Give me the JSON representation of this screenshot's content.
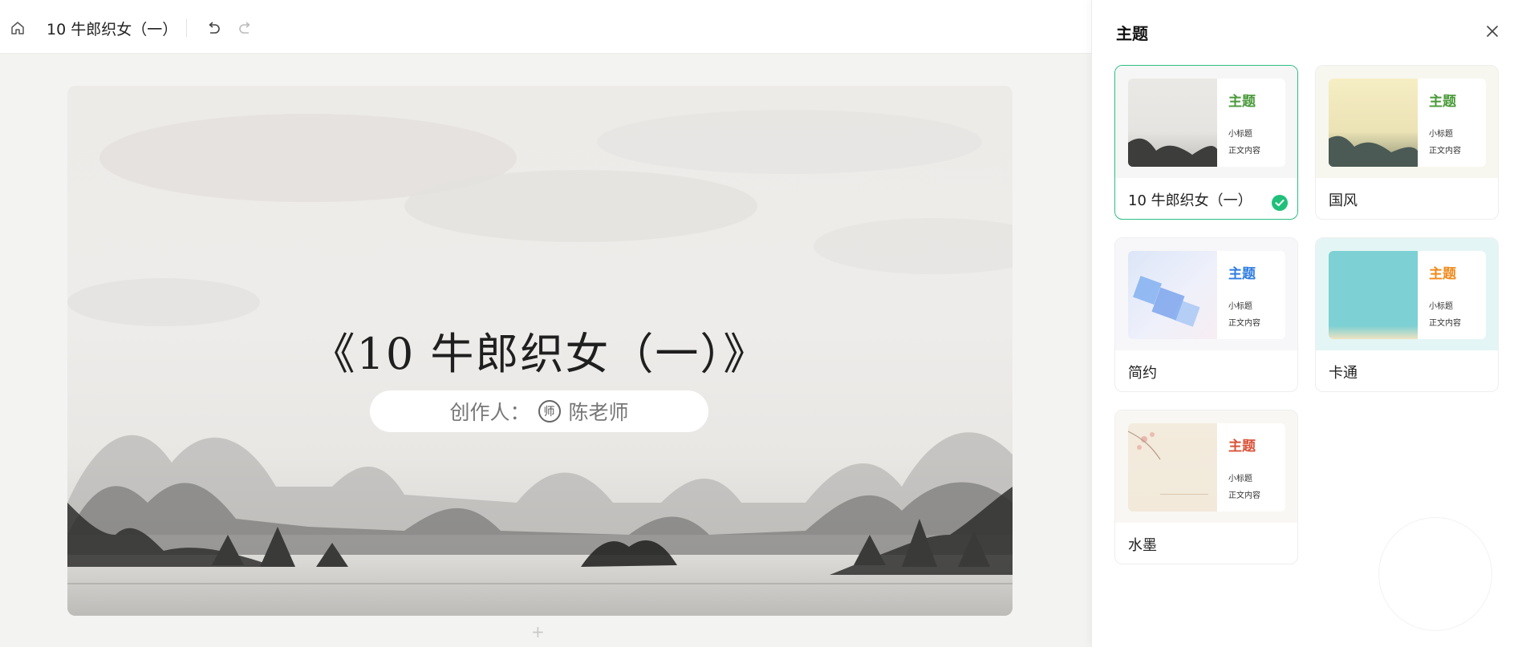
{
  "topbar": {
    "home_icon": "home-icon",
    "title": "10 牛郎织女（一）",
    "undo_icon": "undo-icon",
    "redo_icon": "redo-icon"
  },
  "slide": {
    "title": "《10  牛郎织女（一）》",
    "author_prefix": "创作人：",
    "author_badge": "师",
    "author_name": "陈老师",
    "add_icon": "+"
  },
  "panel": {
    "title": "主题",
    "close_icon": "close-icon",
    "themes": [
      {
        "name": "10 牛郎织女（一）",
        "preview_title": "主题",
        "preview_sub": "小标题",
        "preview_body": "正文内容",
        "accent": "#4a9a3a",
        "selected": true
      },
      {
        "name": "国风",
        "preview_title": "主题",
        "preview_sub": "小标题",
        "preview_body": "正文内容",
        "accent": "#4a9a3a",
        "selected": false
      },
      {
        "name": "简约",
        "preview_title": "主题",
        "preview_sub": "小标题",
        "preview_body": "正文内容",
        "accent": "#2f7de1",
        "selected": false
      },
      {
        "name": "卡通",
        "preview_title": "主题",
        "preview_sub": "小标题",
        "preview_body": "正文内容",
        "accent": "#f08a1c",
        "selected": false
      },
      {
        "name": "水墨",
        "preview_title": "主题",
        "preview_sub": "小标题",
        "preview_body": "正文内容",
        "accent": "#d9533a",
        "selected": false
      }
    ]
  },
  "colors": {
    "selected_border": "#2bbf83",
    "check": "#20c07a"
  }
}
